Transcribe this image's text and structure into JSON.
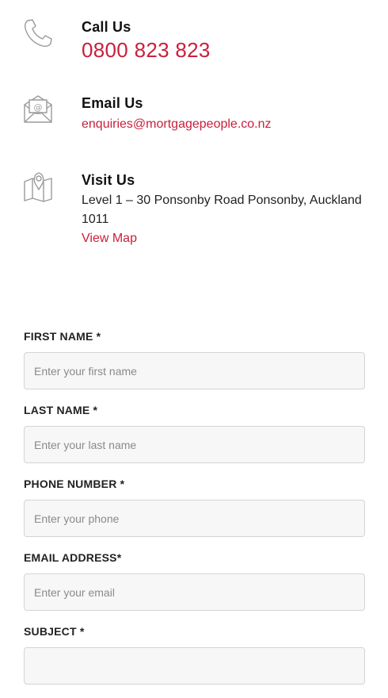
{
  "contact": {
    "call": {
      "heading": "Call Us",
      "number": "0800 823 823",
      "icon": "phone-icon"
    },
    "email": {
      "heading": "Email Us",
      "address": "enquiries@mortgagepeople.co.nz",
      "icon": "envelope-icon"
    },
    "visit": {
      "heading": "Visit Us",
      "address_line1": "Level 1 – 30 Ponsonby Road Ponsonby, Auckland",
      "address_line2": "1011",
      "map_link": "View Map",
      "icon": "map-pin-icon"
    }
  },
  "form": {
    "first_name": {
      "label": "FIRST NAME *",
      "placeholder": "Enter your first name"
    },
    "last_name": {
      "label": "LAST NAME *",
      "placeholder": "Enter your last name"
    },
    "phone": {
      "label": "PHONE NUMBER *",
      "placeholder": "Enter your phone"
    },
    "email": {
      "label": "EMAIL ADDRESS*",
      "placeholder": "Enter your email"
    },
    "subject": {
      "label": "SUBJECT *",
      "placeholder": ""
    }
  },
  "colors": {
    "accent": "#c8203c",
    "icon_gray": "#9a9a9a",
    "input_bg": "#f7f7f7",
    "input_border": "#d4d4d4"
  }
}
